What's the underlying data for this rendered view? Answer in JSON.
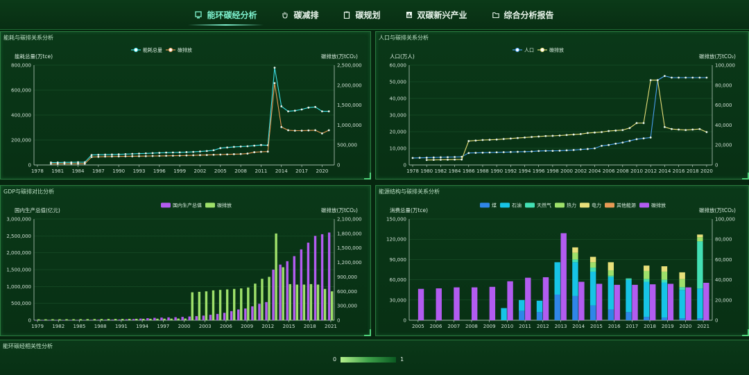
{
  "nav": {
    "tabs": [
      {
        "label": "能环碳经分析",
        "icon": "monitor-icon",
        "active": true
      },
      {
        "label": "碳减排",
        "icon": "hand-icon",
        "active": false
      },
      {
        "label": "碳规划",
        "icon": "clipboard-icon",
        "active": false
      },
      {
        "label": "双碳新兴产业",
        "icon": "chart-icon",
        "active": false
      },
      {
        "label": "综合分析报告",
        "icon": "folder-icon",
        "active": false
      }
    ]
  },
  "panels": {
    "energy": {
      "title": "能耗与碳排关系分析"
    },
    "population": {
      "title": "人口与碳排关系分析"
    },
    "gdp": {
      "title": "GDP与碳排对比分析"
    },
    "structure": {
      "title": "能源结构与碳排关系分析"
    },
    "correlation": {
      "title": "能环碳经相关性分析"
    }
  },
  "visual_map": {
    "min_label": "0",
    "max_label": "1"
  },
  "colors": {
    "cyan": "#3ee0e6",
    "orange": "#e79a55",
    "yellow": "#e8e07a",
    "blue": "#4aa0f0",
    "purple": "#b25cf0",
    "green": "#9ee06a"
  },
  "chart_data": [
    {
      "type": "line",
      "legend": [
        "能耗总量",
        "碳排放"
      ],
      "ylabel": "能耗总量(万tce)",
      "y2label": "碳排放(万tCO₂)",
      "ylim": [
        0,
        800000
      ],
      "y2lim": [
        0,
        2500000
      ],
      "yticks": [
        "0",
        "200,000",
        "400,000",
        "600,000",
        "800,000"
      ],
      "y2ticks": [
        "0",
        "500,000",
        "1,000,000",
        "1,500,000",
        "2,000,000",
        "2,500,000"
      ],
      "xticks": [
        "1978",
        "1981",
        "1984",
        "1987",
        "1990",
        "1993",
        "1996",
        "1999",
        "2002",
        "2005",
        "2008",
        "2011",
        "2014",
        "2017",
        "2020"
      ],
      "x": [
        1980,
        1981,
        1982,
        1983,
        1984,
        1985,
        1986,
        1987,
        1988,
        1989,
        1990,
        1991,
        1992,
        1993,
        1994,
        1995,
        1996,
        1997,
        1998,
        1999,
        2000,
        2001,
        2002,
        2003,
        2004,
        2005,
        2006,
        2007,
        2008,
        2009,
        2010,
        2011,
        2012,
        2013,
        2014,
        2015,
        2016,
        2017,
        2018,
        2019,
        2020,
        2021
      ],
      "series": [
        {
          "name": "能耗总量",
          "axis": 0,
          "values": [
            20000,
            20000,
            21000,
            21000,
            22000,
            22000,
            80000,
            82000,
            83000,
            84000,
            85000,
            87000,
            89000,
            91000,
            93000,
            95000,
            97000,
            99000,
            100000,
            101000,
            103000,
            105000,
            108000,
            112000,
            118000,
            135000,
            140000,
            145000,
            148000,
            150000,
            155000,
            160000,
            158000,
            780000,
            470000,
            430000,
            435000,
            445000,
            460000,
            465000,
            430000,
            430000
          ]
        },
        {
          "name": "碳排放",
          "axis": 1,
          "values": [
            30000,
            31000,
            32000,
            32000,
            33000,
            33000,
            200000,
            205000,
            210000,
            212000,
            214000,
            216000,
            218000,
            220000,
            222000,
            225000,
            228000,
            230000,
            232000,
            235000,
            238000,
            242000,
            246000,
            250000,
            255000,
            260000,
            265000,
            270000,
            275000,
            285000,
            320000,
            330000,
            335000,
            2050000,
            950000,
            870000,
            860000,
            860000,
            865000,
            870000,
            790000,
            870000
          ]
        }
      ]
    },
    {
      "type": "line",
      "legend": [
        "人口",
        "碳排放"
      ],
      "ylabel": "人口(万人)",
      "y2label": "碳排放(万tCO₂)",
      "ylim": [
        0,
        60000
      ],
      "y2lim": [
        0,
        100000
      ],
      "yticks": [
        "0",
        "10,000",
        "20,000",
        "30,000",
        "40,000",
        "50,000",
        "60,000"
      ],
      "y2ticks": [
        "0",
        "20,000",
        "40,000",
        "60,000",
        "80,000",
        "100,000"
      ],
      "xticks": [
        "1978",
        "1980",
        "1982",
        "1984",
        "1986",
        "1988",
        "1990",
        "1992",
        "1994",
        "1996",
        "1998",
        "2000",
        "2002",
        "2004",
        "2006",
        "2008",
        "2010",
        "2012",
        "2014",
        "2016",
        "2018",
        "2020"
      ],
      "x": [
        1978,
        1979,
        1980,
        1981,
        1982,
        1983,
        1984,
        1985,
        1986,
        1987,
        1988,
        1989,
        1990,
        1991,
        1992,
        1993,
        1994,
        1995,
        1996,
        1997,
        1998,
        1999,
        2000,
        2001,
        2002,
        2003,
        2004,
        2005,
        2006,
        2007,
        2008,
        2009,
        2010,
        2011,
        2012,
        2013,
        2014,
        2015,
        2016,
        2017,
        2018,
        2019,
        2020
      ],
      "series": [
        {
          "name": "人口",
          "axis": 0,
          "values": [
            4200,
            4300,
            4400,
            4500,
            4600,
            4700,
            4800,
            4900,
            7200,
            7300,
            7400,
            7500,
            7600,
            7700,
            7800,
            7900,
            8000,
            8100,
            8400,
            8500,
            8500,
            8600,
            8800,
            9000,
            9300,
            9600,
            10000,
            11500,
            12000,
            12800,
            13500,
            14500,
            15500,
            16000,
            16500,
            51000,
            53500,
            52500,
            52500,
            52500,
            52500,
            52500,
            52500
          ]
        },
        {
          "name": "碳排放",
          "axis": 1,
          "values": [
            null,
            null,
            5000,
            5100,
            5200,
            5300,
            5400,
            5500,
            24000,
            24500,
            25000,
            25200,
            25500,
            26000,
            26500,
            27000,
            27500,
            28000,
            28500,
            29000,
            29200,
            29500,
            30000,
            30500,
            31000,
            32000,
            32500,
            33000,
            34000,
            34500,
            35000,
            37000,
            42000,
            42000,
            85000,
            85000,
            38000,
            36000,
            35500,
            35000,
            35500,
            36000,
            33000
          ]
        }
      ]
    },
    {
      "type": "bar",
      "legend": [
        "国内生产总值",
        "碳排放"
      ],
      "ylabel": "国内生产总值(亿元)",
      "y2label": "碳排放(万tCO₂)",
      "ylim": [
        0,
        3000000
      ],
      "y2lim": [
        0,
        2100000
      ],
      "yticks": [
        "0",
        "500,000",
        "1,000,000",
        "1,500,000",
        "2,000,000",
        "2,500,000",
        "3,000,000"
      ],
      "y2ticks": [
        "0",
        "300,000",
        "600,000",
        "900,000",
        "1,200,000",
        "1,500,000",
        "1,800,000",
        "2,100,000"
      ],
      "xticks": [
        "1979",
        "1982",
        "1985",
        "1988",
        "1991",
        "1994",
        "1997",
        "2000",
        "2003",
        "2006",
        "2009",
        "2012",
        "2015",
        "2018",
        "2021"
      ],
      "categories": [
        "1979",
        "1980",
        "1981",
        "1982",
        "1983",
        "1984",
        "1985",
        "1986",
        "1987",
        "1988",
        "1989",
        "1990",
        "1991",
        "1992",
        "1993",
        "1994",
        "1995",
        "1996",
        "1997",
        "1998",
        "1999",
        "2000",
        "2001",
        "2002",
        "2003",
        "2004",
        "2005",
        "2006",
        "2007",
        "2008",
        "2009",
        "2010",
        "2011",
        "2012",
        "2013",
        "2014",
        "2015",
        "2016",
        "2017",
        "2018",
        "2019",
        "2020",
        "2021"
      ],
      "series": [
        {
          "name": "国内生产总值",
          "axis": 0,
          "values": [
            4000,
            4500,
            5000,
            5400,
            6000,
            7200,
            9000,
            10300,
            12100,
            15100,
            17100,
            18900,
            22000,
            27200,
            35700,
            48600,
            61300,
            71800,
            79700,
            85200,
            90600,
            100300,
            110900,
            121700,
            137400,
            161800,
            187300,
            219400,
            270000,
            319500,
            349100,
            412100,
            487900,
            538600,
            1500000,
            1650000,
            1750000,
            1900000,
            2100000,
            2300000,
            2500000,
            2550000,
            2600000
          ]
        },
        {
          "name": "碳排放",
          "axis": 1,
          "values": [
            20000,
            20000,
            21000,
            21000,
            22000,
            22000,
            23000,
            24000,
            25000,
            26000,
            27000,
            28000,
            28000,
            29000,
            30000,
            30000,
            31000,
            32000,
            33000,
            34000,
            35000,
            36000,
            580000,
            590000,
            600000,
            620000,
            630000,
            640000,
            650000,
            660000,
            680000,
            760000,
            860000,
            900000,
            1800000,
            1100000,
            750000,
            740000,
            740000,
            750000,
            740000,
            650000,
            600000
          ]
        }
      ]
    },
    {
      "type": "bar",
      "stacked": true,
      "legend": [
        "煤",
        "石油",
        "天然气",
        "热力",
        "电力",
        "其他能源",
        "碳排放"
      ],
      "ylabel": "消费总量(万tce)",
      "y2label": "碳排放(万tCO₂)",
      "ylim": [
        0,
        150000
      ],
      "y2lim": [
        0,
        100000
      ],
      "yticks": [
        "0",
        "30,000",
        "60,000",
        "90,000",
        "120,000",
        "150,000"
      ],
      "y2ticks": [
        "0",
        "20,000",
        "40,000",
        "60,000",
        "80,000",
        "100,000"
      ],
      "categories": [
        "2005",
        "2006",
        "2007",
        "2008",
        "2009",
        "2010",
        "2011",
        "2012",
        "2013",
        "2014",
        "2015",
        "2016",
        "2017",
        "2018",
        "2019",
        "2020",
        "2021"
      ],
      "series": [
        {
          "name": "煤",
          "stack": "a",
          "values": [
            0,
            0,
            0,
            0,
            0,
            0,
            14000,
            12000,
            38000,
            36000,
            22000,
            16000,
            12000,
            5000,
            4000,
            3000,
            3000
          ]
        },
        {
          "name": "石油",
          "stack": "a",
          "values": [
            0,
            0,
            0,
            0,
            0,
            18000,
            16000,
            17000,
            48000,
            50000,
            50000,
            48000,
            48000,
            52000,
            52000,
            42000,
            44000
          ]
        },
        {
          "name": "天然气",
          "stack": "a",
          "values": [
            0,
            0,
            0,
            0,
            0,
            0,
            0,
            0,
            0,
            4000,
            6000,
            2000,
            2000,
            4000,
            4000,
            4000,
            70000
          ]
        },
        {
          "name": "热力",
          "stack": "a",
          "values": [
            0,
            0,
            0,
            0,
            0,
            0,
            0,
            0,
            0,
            10000,
            8000,
            8000,
            0,
            12000,
            12000,
            12000,
            6000
          ]
        },
        {
          "name": "电力",
          "stack": "a",
          "values": [
            0,
            0,
            0,
            0,
            0,
            0,
            0,
            0,
            0,
            8000,
            8000,
            12000,
            0,
            8000,
            8000,
            10000,
            4000
          ]
        },
        {
          "name": "其他能源",
          "stack": "a",
          "values": [
            0,
            0,
            0,
            0,
            0,
            0,
            0,
            0,
            0,
            0,
            0,
            0,
            0,
            0,
            0,
            0,
            0
          ]
        },
        {
          "name": "碳排放",
          "stack": "b",
          "axis": 1,
          "values": [
            31000,
            31500,
            32500,
            32500,
            33000,
            38500,
            42000,
            42500,
            86000,
            38000,
            36000,
            35000,
            35000,
            35500,
            36000,
            32500,
            37000
          ]
        }
      ]
    }
  ]
}
